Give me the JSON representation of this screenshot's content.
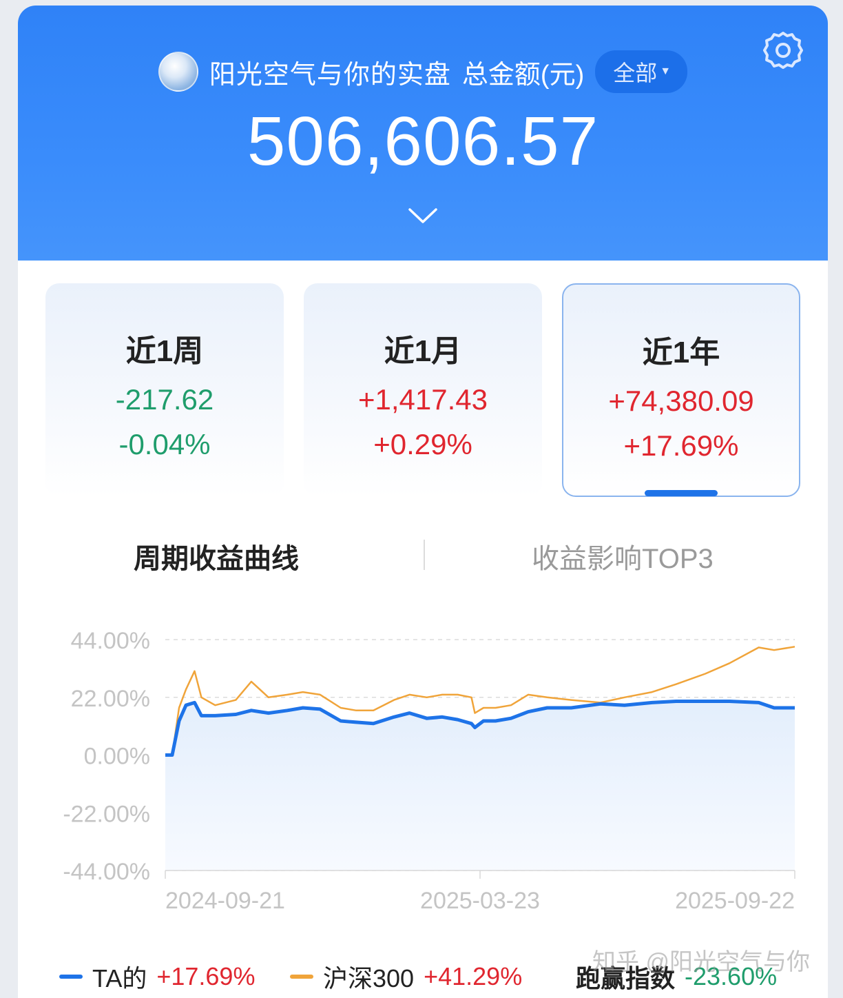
{
  "header": {
    "account_name": "阳光空气与你的实盘",
    "total_label": "总金额(元)",
    "scope_label": "全部",
    "total_amount": "506,606.57",
    "background_color": "#3a8cfb"
  },
  "icons": {
    "settings": "gear-icon",
    "expand": "chevron-down-icon",
    "scope_caret": "caret-down-icon"
  },
  "periods": [
    {
      "title": "近1周",
      "amount": "-217.62",
      "pct": "-0.04%",
      "trend": "down"
    },
    {
      "title": "近1月",
      "amount": "+1,417.43",
      "pct": "+0.29%",
      "trend": "up"
    },
    {
      "title": "近1年",
      "amount": "+74,380.09",
      "pct": "+17.69%",
      "trend": "up",
      "selected": true
    }
  ],
  "tabs": {
    "curve": "周期收益曲线",
    "top3": "收益影响TOP3",
    "active": "curve"
  },
  "colors": {
    "up": "#e0262f",
    "down": "#1f9d6c",
    "ta_line": "#1e73e8",
    "index_line": "#f0a43a"
  },
  "chart_data": {
    "type": "line",
    "y_ticks": [
      "44.00%",
      "22.00%",
      "0.00%",
      "-22.00%",
      "-44.00%"
    ],
    "ylim": [
      -44,
      44
    ],
    "x_tick_labels": [
      "2024-09-21",
      "2025-03-23",
      "2025-09-22"
    ],
    "xlim": [
      "2024-09-21",
      "2025-09-22"
    ],
    "grid": true,
    "series": [
      {
        "name": "TA的",
        "dates": [
          "2024-09-21",
          "2024-09-25",
          "2024-09-29",
          "2024-10-03",
          "2024-10-08",
          "2024-10-12",
          "2024-10-20",
          "2024-11-01",
          "2024-11-10",
          "2024-11-20",
          "2024-12-01",
          "2024-12-10",
          "2024-12-20",
          "2025-01-01",
          "2025-01-10",
          "2025-01-20",
          "2025-02-01",
          "2025-02-10",
          "2025-02-20",
          "2025-03-01",
          "2025-03-10",
          "2025-03-18",
          "2025-03-20",
          "2025-03-25",
          "2025-04-01",
          "2025-04-10",
          "2025-04-20",
          "2025-05-01",
          "2025-05-15",
          "2025-06-01",
          "2025-06-15",
          "2025-07-01",
          "2025-07-15",
          "2025-08-01",
          "2025-08-15",
          "2025-09-01",
          "2025-09-10",
          "2025-09-22"
        ],
        "values": [
          0,
          0,
          13,
          19,
          20,
          15,
          15,
          15.5,
          17,
          16,
          17,
          18,
          17.5,
          13,
          12.5,
          12,
          14.5,
          16,
          14,
          14.5,
          13.5,
          12,
          10.5,
          13,
          13,
          14,
          16.5,
          18,
          18,
          19.5,
          19,
          20,
          20.5,
          20.5,
          20.5,
          20,
          18,
          18
        ]
      },
      {
        "name": "沪深300",
        "dates": [
          "2024-09-21",
          "2024-09-25",
          "2024-09-29",
          "2024-10-03",
          "2024-10-08",
          "2024-10-12",
          "2024-10-20",
          "2024-11-01",
          "2024-11-10",
          "2024-11-20",
          "2024-12-01",
          "2024-12-10",
          "2024-12-20",
          "2025-01-01",
          "2025-01-10",
          "2025-01-20",
          "2025-02-01",
          "2025-02-10",
          "2025-02-20",
          "2025-03-01",
          "2025-03-10",
          "2025-03-18",
          "2025-03-20",
          "2025-03-25",
          "2025-04-01",
          "2025-04-10",
          "2025-04-20",
          "2025-05-01",
          "2025-05-15",
          "2025-06-01",
          "2025-06-15",
          "2025-07-01",
          "2025-07-15",
          "2025-08-01",
          "2025-08-15",
          "2025-09-01",
          "2025-09-10",
          "2025-09-22"
        ],
        "values": [
          0,
          0,
          18,
          25,
          32,
          22,
          19,
          21,
          28,
          22,
          23,
          24,
          23,
          18,
          17,
          17,
          21,
          23,
          22,
          23,
          23,
          22,
          16,
          18,
          18,
          19,
          23,
          22,
          21,
          20,
          22,
          24,
          27,
          31,
          35,
          41,
          40,
          41.29
        ]
      }
    ]
  },
  "legend": [
    {
      "label": "TA的",
      "value": "+17.69%",
      "trend": "up"
    },
    {
      "label": "沪深300",
      "value": "+41.29%",
      "trend": "up"
    },
    {
      "label": "跑赢指数",
      "value": "-23.60%",
      "trend": "down"
    }
  ],
  "watermark": "知乎 @阳光空气与你"
}
